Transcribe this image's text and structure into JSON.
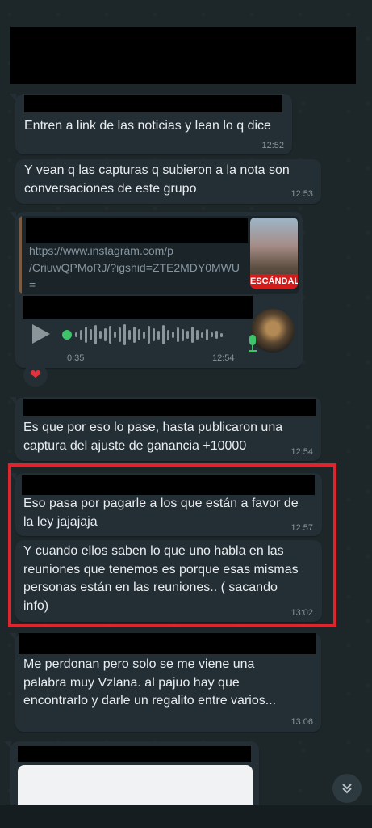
{
  "messages": [
    {
      "text": "Entren a link de las noticias y lean lo q dice",
      "time": "12:52"
    },
    {
      "text": "Y vean q las capturas q subieron a la nota son\nconversaciones de este grupo",
      "time": "12:53"
    },
    {
      "link_url": "https://www.instagram.com/p\n/CriuwQPMoRJ/?igshid=ZTE2MDY0MWU\n=",
      "thumb_label": "ESCÁNDALO",
      "audio_duration": "0:35",
      "time": "12:54",
      "reaction": "❤"
    },
    {
      "text": "Es que por eso lo pase, hasta publicaron una\ncaptura del ajuste de ganancia +10000",
      "time": "12:54"
    },
    {
      "text": "Eso pasa por pagarle a los que están a favor de\nla ley jajajaja",
      "time": "12:57"
    },
    {
      "text": "Y cuando ellos saben lo que uno habla en las\nreuniones que tenemos es porque esas mismas\npersonas están en las reuniones.. ( sacando\ninfo)",
      "time": "13:02"
    },
    {
      "text": "Me perdonan pero solo se me viene una\npalabra muy Vzlana. al pajuo hay que\nencontrarlo y darle un regalito entre varios...",
      "time": "13:06"
    }
  ],
  "icons": {
    "play": "play-icon",
    "mic": "microphone-icon",
    "scroll_down": "double-chevron-down-icon",
    "heart": "heart-icon"
  },
  "colors": {
    "background": "#1d2629",
    "bubble": "#232e35",
    "highlight": "#e0242e",
    "mic": "#3ec36a"
  }
}
